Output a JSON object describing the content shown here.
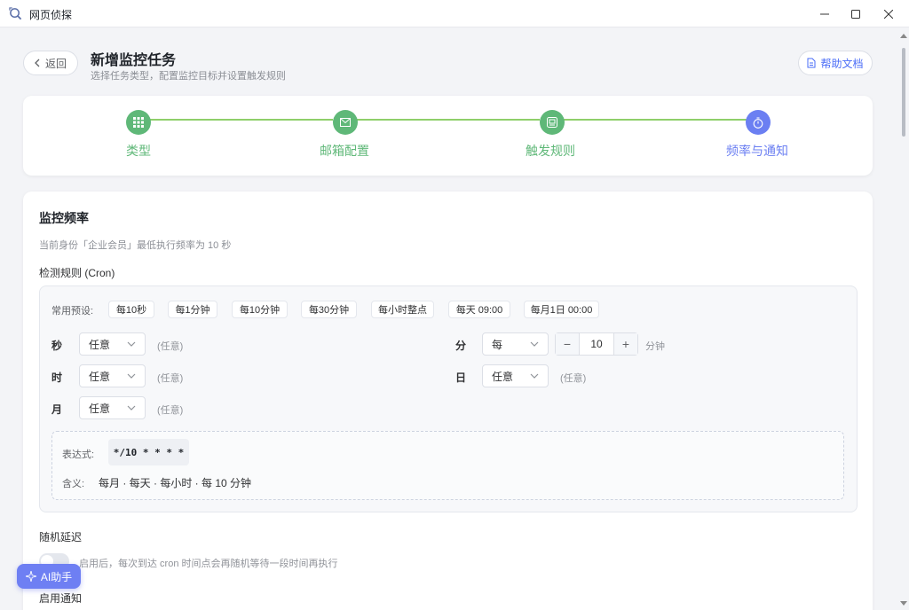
{
  "app": {
    "title": "网页侦探",
    "icon": "magnifier-app-icon"
  },
  "window_controls": {
    "minimize": "minimize-icon",
    "maximize": "maximize-icon",
    "close": "close-icon"
  },
  "header": {
    "back_label": "返回",
    "title": "新增监控任务",
    "subtitle": "选择任务类型，配置监控目标并设置触发规则",
    "help_label": "帮助文档"
  },
  "steps": [
    {
      "label": "类型",
      "icon": "grid-icon",
      "status": "done"
    },
    {
      "label": "邮箱配置",
      "icon": "mail-icon",
      "status": "done"
    },
    {
      "label": "触发规则",
      "icon": "rule-icon",
      "status": "done"
    },
    {
      "label": "频率与通知",
      "icon": "timer-icon",
      "status": "active"
    }
  ],
  "colors": {
    "done": "#5fb878",
    "active": "#6b7ff2",
    "line": "#8fcf6a"
  },
  "monitor": {
    "title": "监控频率",
    "hint": "当前身份「企业会员」最低执行频率为 10 秒",
    "cron_label": "检测规则 (Cron)",
    "preset_label": "常用预设:",
    "presets": [
      "每10秒",
      "每1分钟",
      "每10分钟",
      "每30分钟",
      "每小时整点",
      "每天 09:00",
      "每月1日 00:00"
    ],
    "fields": {
      "second": {
        "label": "秒",
        "value": "任意",
        "note": "(任意)"
      },
      "hour": {
        "label": "时",
        "value": "任意",
        "note": "(任意)"
      },
      "month": {
        "label": "月",
        "value": "任意",
        "note": "(任意)"
      },
      "minute": {
        "label": "分",
        "value": "每",
        "step": "10",
        "unit": "分钟"
      },
      "day": {
        "label": "日",
        "value": "任意",
        "note": "(任意)"
      }
    },
    "expression_label": "表达式:",
    "expression": "*/10 * * * *",
    "meaning_label": "含义:",
    "meaning": "每月 · 每天 · 每小时 · 每 10 分钟"
  },
  "random_delay": {
    "title": "随机延迟",
    "enabled": false,
    "description": "启用后，每次到达 cron 时间点会再随机等待一段时间再执行"
  },
  "notify": {
    "title": "启用通知"
  },
  "ai_button": {
    "label": "AI助手"
  }
}
